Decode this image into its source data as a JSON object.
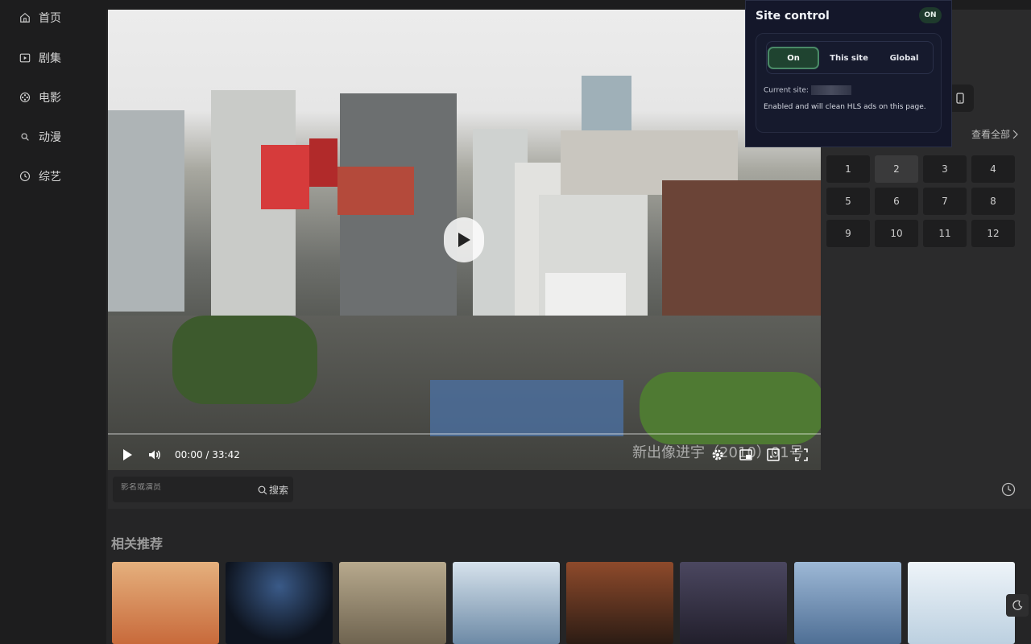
{
  "sidebar": {
    "items": [
      {
        "label": "首页",
        "icon": "home-icon"
      },
      {
        "label": "剧集",
        "icon": "tv-series-icon"
      },
      {
        "label": "电影",
        "icon": "film-reel-icon"
      },
      {
        "label": "动漫",
        "icon": "anime-icon"
      },
      {
        "label": "综艺",
        "icon": "variety-clock-icon"
      }
    ]
  },
  "player": {
    "time": "00:00 / 33:42",
    "overlay_title": "新出像进宇（2010）01号",
    "progress": 0
  },
  "episodes": {
    "see_all": "查看全部",
    "list": [
      "1",
      "2",
      "3",
      "4",
      "5",
      "6",
      "7",
      "8",
      "9",
      "10",
      "11",
      "12"
    ],
    "active": "2"
  },
  "search": {
    "placeholder": "影名或演员",
    "button": "搜索"
  },
  "related": {
    "title": "相关推荐",
    "poster_colors": [
      "#c86a3b",
      "#1b2434",
      "#8a7a62",
      "#6d8aa6",
      "#5a3d2c",
      "#3c3a48",
      "#6f8fb2",
      "#d7e3ee"
    ]
  },
  "popup": {
    "title": "Site control",
    "badge": "ON",
    "modes": [
      "On",
      "This site",
      "Global"
    ],
    "active_mode": "On",
    "current_site_label": "Current site:",
    "message": "Enabled and will clean HLS ads on this page."
  },
  "colors": {
    "accent_green": "#1f4330",
    "popup_bg": "#14172a",
    "page_bg": "#1d1d1e"
  }
}
